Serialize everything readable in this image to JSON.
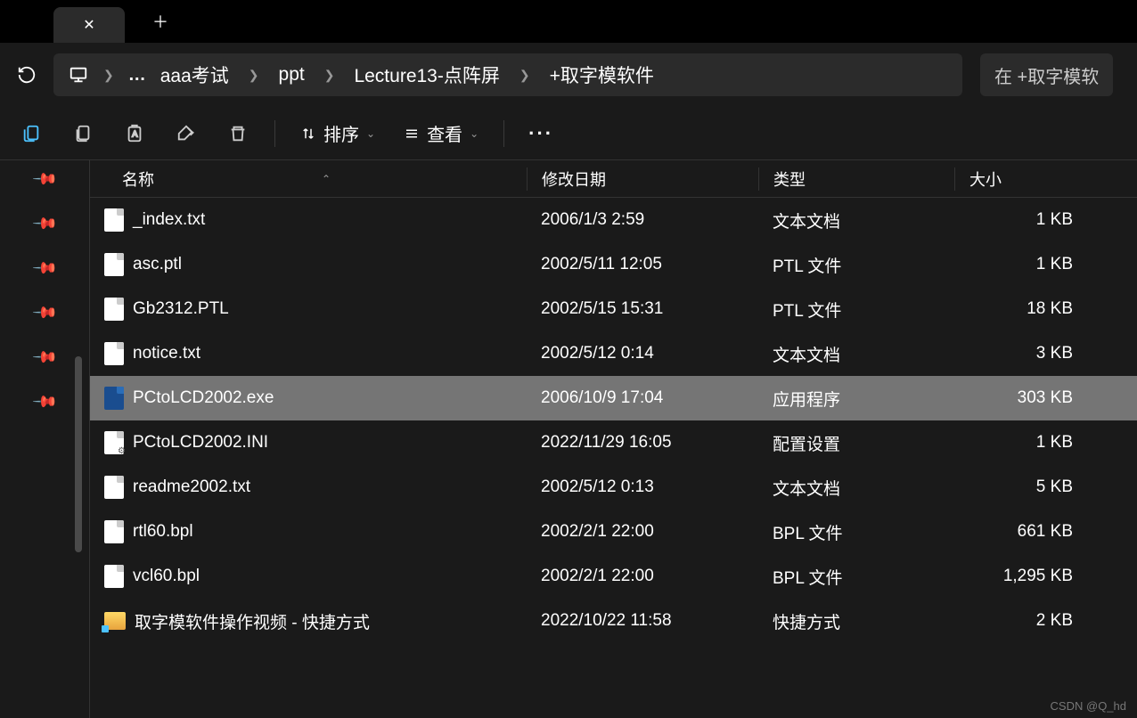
{
  "breadcrumb": {
    "items": [
      "aaa考试",
      "ppt",
      "Lecture13-点阵屏",
      "+取字模软件"
    ]
  },
  "search": {
    "placeholder": "在 +取字模软"
  },
  "toolbar": {
    "sort_label": "排序",
    "view_label": "查看"
  },
  "columns": {
    "name": "名称",
    "date": "修改日期",
    "type": "类型",
    "size": "大小"
  },
  "files": [
    {
      "name": "_index.txt",
      "date": "2006/1/3 2:59",
      "type": "文本文档",
      "size": "1 KB",
      "icon": "txt",
      "selected": false
    },
    {
      "name": "asc.ptl",
      "date": "2002/5/11 12:05",
      "type": "PTL 文件",
      "size": "1 KB",
      "icon": "txt",
      "selected": false
    },
    {
      "name": "Gb2312.PTL",
      "date": "2002/5/15 15:31",
      "type": "PTL 文件",
      "size": "18 KB",
      "icon": "txt",
      "selected": false
    },
    {
      "name": "notice.txt",
      "date": "2002/5/12 0:14",
      "type": "文本文档",
      "size": "3 KB",
      "icon": "txt",
      "selected": false
    },
    {
      "name": "PCtoLCD2002.exe",
      "date": "2006/10/9 17:04",
      "type": "应用程序",
      "size": "303 KB",
      "icon": "exe",
      "selected": true
    },
    {
      "name": "PCtoLCD2002.INI",
      "date": "2022/11/29 16:05",
      "type": "配置设置",
      "size": "1 KB",
      "icon": "ini",
      "selected": false
    },
    {
      "name": "readme2002.txt",
      "date": "2002/5/12 0:13",
      "type": "文本文档",
      "size": "5 KB",
      "icon": "txt",
      "selected": false
    },
    {
      "name": "rtl60.bpl",
      "date": "2002/2/1 22:00",
      "type": "BPL 文件",
      "size": "661 KB",
      "icon": "txt",
      "selected": false
    },
    {
      "name": "vcl60.bpl",
      "date": "2002/2/1 22:00",
      "type": "BPL 文件",
      "size": "1,295 KB",
      "icon": "txt",
      "selected": false
    },
    {
      "name": "取字模软件操作视频 - 快捷方式",
      "date": "2022/10/22 11:58",
      "type": "快捷方式",
      "size": "2 KB",
      "icon": "folder",
      "selected": false
    }
  ],
  "watermark": "CSDN @Q_hd"
}
